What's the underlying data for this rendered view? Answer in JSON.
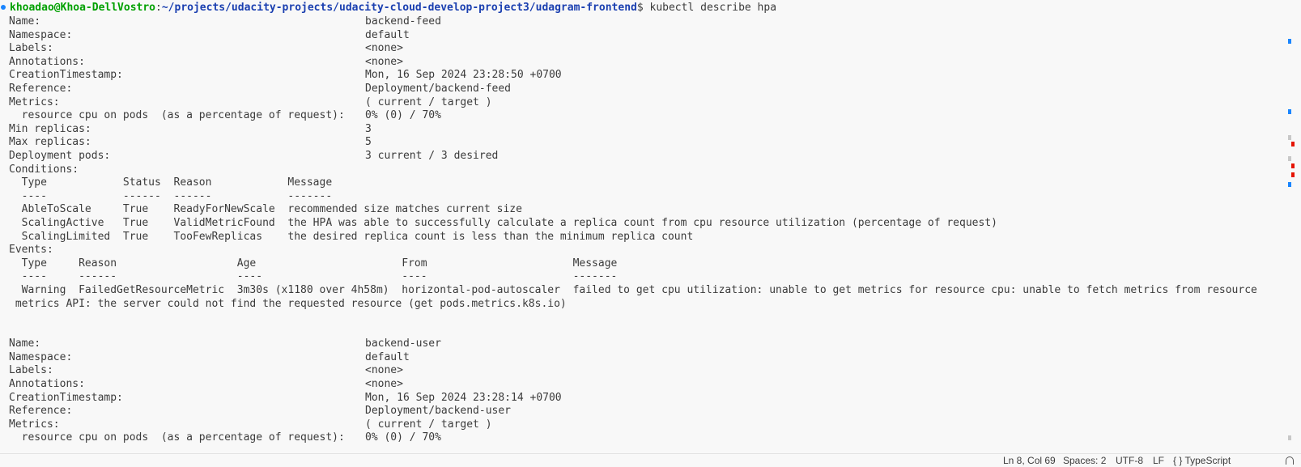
{
  "prompt": {
    "user_host": "khoadao@Khoa-DellVostro",
    "path": "~/projects/udacity-projects/udacity-cloud-develop-project3/udagram-frontend",
    "symbol": "$",
    "command": " kubectl describe hpa"
  },
  "hpa1": {
    "name": {
      "label": "Name:",
      "value": "backend-feed"
    },
    "namespace": {
      "label": "Namespace:",
      "value": "default"
    },
    "labels": {
      "label": "Labels:",
      "value": "<none>"
    },
    "annotations": {
      "label": "Annotations:",
      "value": "<none>"
    },
    "creation": {
      "label": "CreationTimestamp:",
      "value": "Mon, 16 Sep 2024 23:28:50 +0700"
    },
    "reference": {
      "label": "Reference:",
      "value": "Deployment/backend-feed"
    },
    "metrics": {
      "label": "Metrics:",
      "value": "( current / target )"
    },
    "resource": {
      "label": "  resource cpu on pods  (as a percentage of request):",
      "value": "0% (0) / 70%"
    },
    "min_replicas": {
      "label": "Min replicas:",
      "value": "3"
    },
    "max_replicas": {
      "label": "Max replicas:",
      "value": "5"
    },
    "deployment_pods": {
      "label": "Deployment pods:",
      "value": "3 current / 3 desired"
    },
    "conditions_label": "Conditions:",
    "conditions_header": "  Type            Status  Reason            Message",
    "conditions_sep": "  ----            ------  ------            -------",
    "conditions_rows": [
      "  AbleToScale     True    ReadyForNewScale  recommended size matches current size",
      "  ScalingActive   True    ValidMetricFound  the HPA was able to successfully calculate a replica count from cpu resource utilization (percentage of request)",
      "  ScalingLimited  True    TooFewReplicas    the desired replica count is less than the minimum replica count"
    ],
    "events_label": "Events:",
    "events_header": "  Type     Reason                   Age                       From                       Message",
    "events_sep": "  ----     ------                   ----                      ----                       -------",
    "events_row": "  Warning  FailedGetResourceMetric  3m30s (x1180 over 4h58m)  horizontal-pod-autoscaler  failed to get cpu utilization: unable to get metrics for resource cpu: unable to fetch metrics from resource",
    "events_row_wrap": " metrics API: the server could not find the requested resource (get pods.metrics.k8s.io)"
  },
  "hpa2": {
    "name": {
      "label": "Name:",
      "value": "backend-user"
    },
    "namespace": {
      "label": "Namespace:",
      "value": "default"
    },
    "labels": {
      "label": "Labels:",
      "value": "<none>"
    },
    "annotations": {
      "label": "Annotations:",
      "value": "<none>"
    },
    "creation": {
      "label": "CreationTimestamp:",
      "value": "Mon, 16 Sep 2024 23:28:14 +0700"
    },
    "reference": {
      "label": "Reference:",
      "value": "Deployment/backend-user"
    },
    "metrics": {
      "label": "Metrics:",
      "value": "( current / target )"
    },
    "resource": {
      "label": "  resource cpu on pods  (as a percentage of request):",
      "value": "0% (0) / 70%"
    }
  },
  "status_bar": {
    "cursor": "Ln 8, Col 69",
    "spaces": "Spaces: 2",
    "encoding": "UTF-8",
    "eol": "LF",
    "language": "{ } TypeScript"
  },
  "colors": {
    "background": "#f8f8f8",
    "text": "#3b3b3b",
    "user_host": "#00a000",
    "path": "#1a3fb0",
    "marker_blue": "#1a85ff",
    "marker_red": "#e51400"
  }
}
